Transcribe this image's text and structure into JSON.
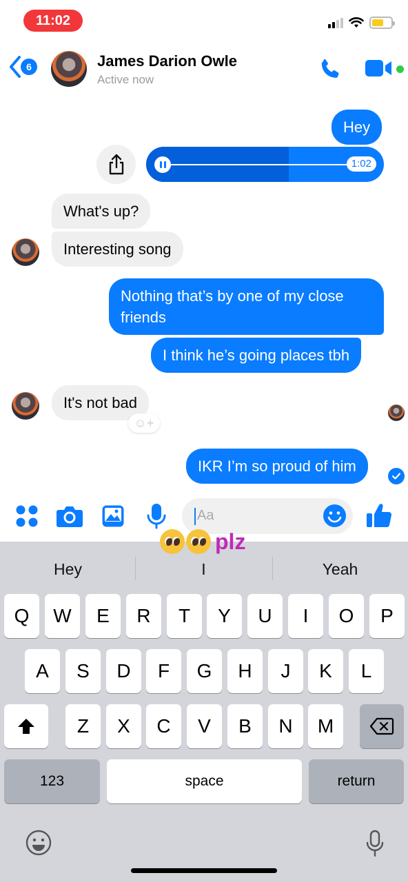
{
  "status_bar": {
    "time": "11:02"
  },
  "header": {
    "back_badge": "6",
    "contact_name": "James Darion Owle",
    "active_status": "Active now"
  },
  "messages": [
    {
      "direction": "out",
      "text": "Hey"
    },
    {
      "direction": "out",
      "type": "voice",
      "duration": "1:02",
      "progress": 0.6
    },
    {
      "direction": "in",
      "text": "What's up?"
    },
    {
      "direction": "in",
      "text": "Interesting song"
    },
    {
      "direction": "out",
      "text_lines": [
        "Nothing that’s by one of my close",
        "friends"
      ]
    },
    {
      "direction": "out",
      "text": "I think he’s going places tbh"
    },
    {
      "direction": "in",
      "text": "It's not bad"
    },
    {
      "direction": "out",
      "text": "IKR I’m so proud of him"
    }
  ],
  "composer": {
    "placeholder": "Aa"
  },
  "overlay_sticker": {
    "text": "plz",
    "emoji": "pleading-face"
  },
  "keyboard": {
    "suggestions": [
      "Hey",
      "I",
      "Yeah"
    ],
    "row1": [
      "Q",
      "W",
      "E",
      "R",
      "T",
      "Y",
      "U",
      "I",
      "O",
      "P"
    ],
    "row2": [
      "A",
      "S",
      "D",
      "F",
      "G",
      "H",
      "J",
      "K",
      "L"
    ],
    "row3": [
      "Z",
      "X",
      "C",
      "V",
      "B",
      "N",
      "M"
    ],
    "numbers_label": "123",
    "space_label": "space",
    "return_label": "return"
  },
  "colors": {
    "accent": "#0a7cff",
    "incoming_bubble": "#efefef",
    "time_pill": "#f2373a",
    "online": "#31cc46",
    "sticker_text": "#c129b6"
  }
}
